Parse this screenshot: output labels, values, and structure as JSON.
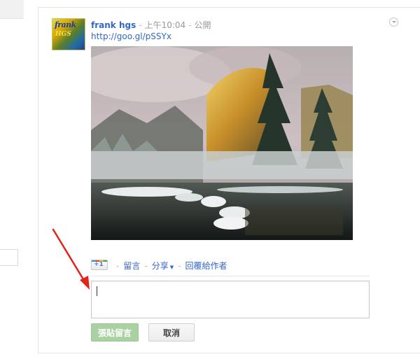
{
  "post": {
    "author": "frank hgs",
    "time": "上午10:04",
    "visibility": "公開",
    "link": "http://goo.gl/pSSYx",
    "avatar_line1": "frank",
    "avatar_line2": "HGS"
  },
  "actions": {
    "plus_one": "+1",
    "comment": "留言",
    "share": "分享",
    "reply_author": "回覆給作者"
  },
  "comment_form": {
    "input_value": "",
    "post_button": "張貼留言",
    "cancel_button": "取消"
  },
  "colors": {
    "link": "#3366cc",
    "post_button_disabled": "#a9d1a1",
    "arrow": "#e2231a"
  },
  "icons": {
    "menu": "chevron-down-circle-icon",
    "plus_one": "google-plus-one-icon",
    "annotation": "red-arrow-icon"
  }
}
